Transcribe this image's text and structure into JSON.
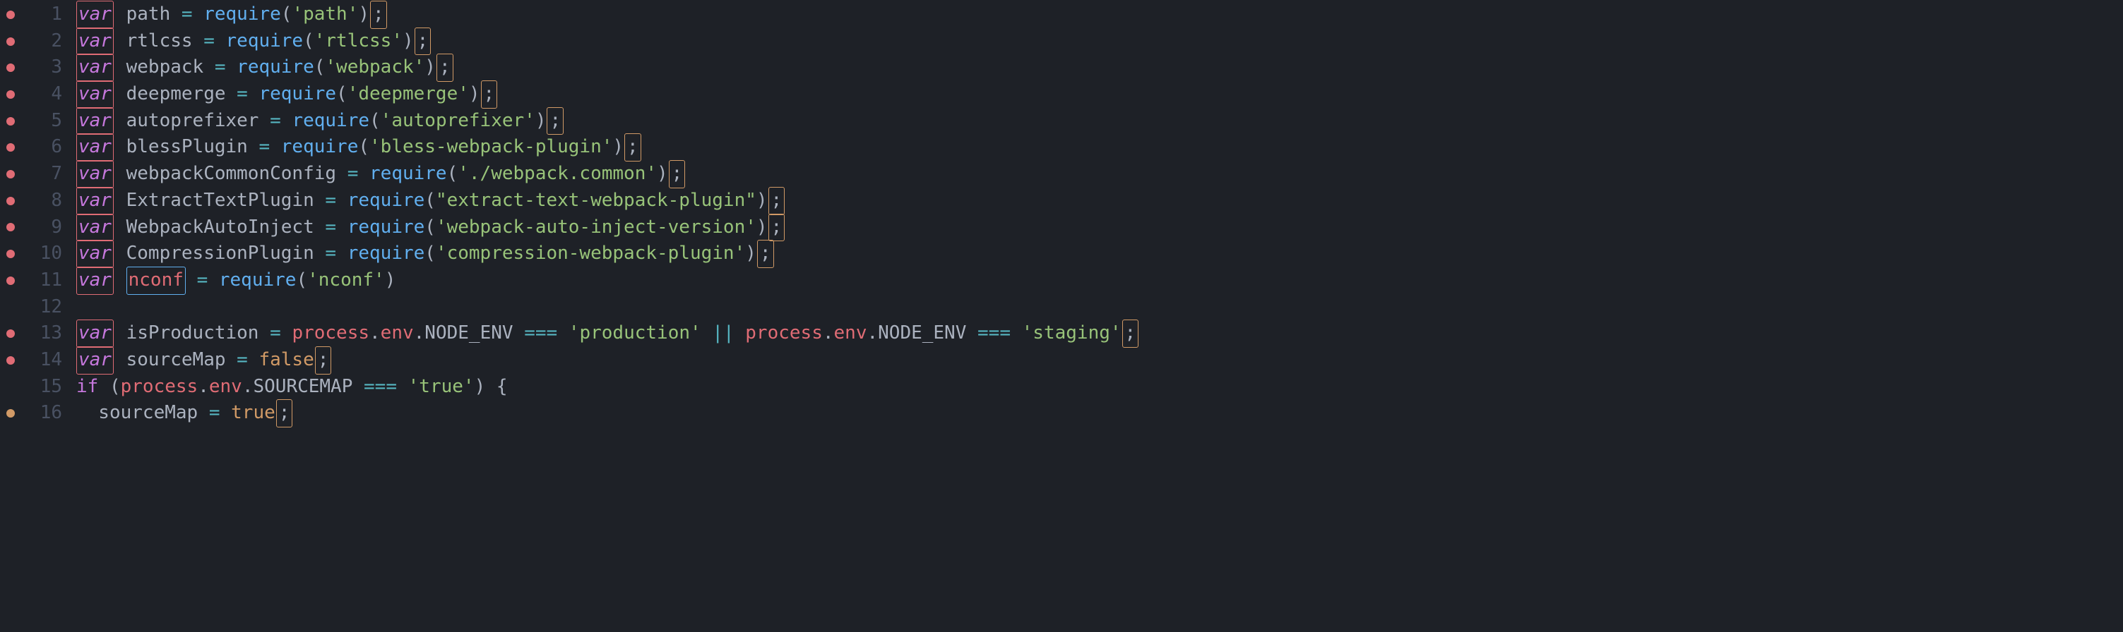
{
  "lines": [
    {
      "num": 1,
      "dot": "red",
      "tokens": [
        [
          "box-var",
          "var"
        ],
        [
          "ident",
          " path "
        ],
        [
          "op",
          "="
        ],
        [
          "ident",
          " "
        ],
        [
          "func",
          "require"
        ],
        [
          "punc",
          "("
        ],
        [
          "str",
          "'path'"
        ],
        [
          "punc",
          ")"
        ],
        [
          "box-semi",
          ";"
        ]
      ]
    },
    {
      "num": 2,
      "dot": "red",
      "tokens": [
        [
          "box-var",
          "var"
        ],
        [
          "ident",
          " rtlcss "
        ],
        [
          "op",
          "="
        ],
        [
          "ident",
          " "
        ],
        [
          "func",
          "require"
        ],
        [
          "punc",
          "("
        ],
        [
          "str",
          "'rtlcss'"
        ],
        [
          "punc",
          ")"
        ],
        [
          "box-semi",
          ";"
        ]
      ]
    },
    {
      "num": 3,
      "dot": "red",
      "tokens": [
        [
          "box-var",
          "var"
        ],
        [
          "ident",
          " webpack "
        ],
        [
          "op",
          "="
        ],
        [
          "ident",
          " "
        ],
        [
          "func",
          "require"
        ],
        [
          "punc",
          "("
        ],
        [
          "str",
          "'webpack'"
        ],
        [
          "punc",
          ")"
        ],
        [
          "box-semi",
          ";"
        ]
      ]
    },
    {
      "num": 4,
      "dot": "red",
      "tokens": [
        [
          "box-var",
          "var"
        ],
        [
          "ident",
          " deepmerge "
        ],
        [
          "op",
          "="
        ],
        [
          "ident",
          " "
        ],
        [
          "func",
          "require"
        ],
        [
          "punc",
          "("
        ],
        [
          "str",
          "'deepmerge'"
        ],
        [
          "punc",
          ")"
        ],
        [
          "box-semi",
          ";"
        ]
      ]
    },
    {
      "num": 5,
      "dot": "red",
      "tokens": [
        [
          "box-var",
          "var"
        ],
        [
          "ident",
          " autoprefixer "
        ],
        [
          "op",
          "="
        ],
        [
          "ident",
          " "
        ],
        [
          "func",
          "require"
        ],
        [
          "punc",
          "("
        ],
        [
          "str",
          "'autoprefixer'"
        ],
        [
          "punc",
          ")"
        ],
        [
          "box-semi",
          ";"
        ]
      ]
    },
    {
      "num": 6,
      "dot": "red",
      "tokens": [
        [
          "box-var",
          "var"
        ],
        [
          "ident",
          " blessPlugin "
        ],
        [
          "op",
          "="
        ],
        [
          "ident",
          " "
        ],
        [
          "func",
          "require"
        ],
        [
          "punc",
          "("
        ],
        [
          "str",
          "'bless-webpack-plugin'"
        ],
        [
          "punc",
          ")"
        ],
        [
          "box-semi",
          ";"
        ]
      ]
    },
    {
      "num": 7,
      "dot": "red",
      "tokens": [
        [
          "box-var",
          "var"
        ],
        [
          "ident",
          " webpackCommonConfig "
        ],
        [
          "op",
          "="
        ],
        [
          "ident",
          " "
        ],
        [
          "func",
          "require"
        ],
        [
          "punc",
          "("
        ],
        [
          "str",
          "'./webpack.common'"
        ],
        [
          "punc",
          ")"
        ],
        [
          "box-semi",
          ";"
        ]
      ]
    },
    {
      "num": 8,
      "dot": "red",
      "tokens": [
        [
          "box-var",
          "var"
        ],
        [
          "ident",
          " ExtractTextPlugin "
        ],
        [
          "op",
          "="
        ],
        [
          "ident",
          " "
        ],
        [
          "func",
          "require"
        ],
        [
          "punc",
          "("
        ],
        [
          "str",
          "\"extract-text-webpack-plugin\""
        ],
        [
          "punc",
          ")"
        ],
        [
          "box-semi",
          ";"
        ]
      ]
    },
    {
      "num": 9,
      "dot": "red",
      "tokens": [
        [
          "box-var",
          "var"
        ],
        [
          "ident",
          " WebpackAutoInject "
        ],
        [
          "op",
          "="
        ],
        [
          "ident",
          " "
        ],
        [
          "func",
          "require"
        ],
        [
          "punc",
          "("
        ],
        [
          "str",
          "'webpack-auto-inject-version'"
        ],
        [
          "punc",
          ")"
        ],
        [
          "box-semi",
          ";"
        ]
      ]
    },
    {
      "num": 10,
      "dot": "red",
      "tokens": [
        [
          "box-var",
          "var"
        ],
        [
          "ident",
          " CompressionPlugin "
        ],
        [
          "op",
          "="
        ],
        [
          "ident",
          " "
        ],
        [
          "func",
          "require"
        ],
        [
          "punc",
          "("
        ],
        [
          "str",
          "'compression-webpack-plugin'"
        ],
        [
          "punc",
          ")"
        ],
        [
          "box-semi",
          ";"
        ]
      ]
    },
    {
      "num": 11,
      "dot": "red",
      "tokens": [
        [
          "box-var",
          "var"
        ],
        [
          "ident",
          " "
        ],
        [
          "box-nconf",
          "nconf"
        ],
        [
          "ident",
          " "
        ],
        [
          "op",
          "="
        ],
        [
          "ident",
          " "
        ],
        [
          "func",
          "require"
        ],
        [
          "punc",
          "("
        ],
        [
          "str",
          "'nconf'"
        ],
        [
          "punc",
          ")"
        ]
      ]
    },
    {
      "num": 12,
      "dot": "",
      "tokens": []
    },
    {
      "num": 13,
      "dot": "red",
      "tokens": [
        [
          "box-var",
          "var"
        ],
        [
          "ident",
          " isProduction "
        ],
        [
          "op",
          "="
        ],
        [
          "ident",
          " "
        ],
        [
          "prop",
          "process"
        ],
        [
          "punc",
          "."
        ],
        [
          "prop",
          "env"
        ],
        [
          "punc",
          "."
        ],
        [
          "ident",
          "NODE_ENV "
        ],
        [
          "op",
          "==="
        ],
        [
          "ident",
          " "
        ],
        [
          "str",
          "'production'"
        ],
        [
          "ident",
          " "
        ],
        [
          "op",
          "||"
        ],
        [
          "ident",
          " "
        ],
        [
          "prop",
          "process"
        ],
        [
          "punc",
          "."
        ],
        [
          "prop",
          "env"
        ],
        [
          "punc",
          "."
        ],
        [
          "ident",
          "NODE_ENV "
        ],
        [
          "op",
          "==="
        ],
        [
          "ident",
          " "
        ],
        [
          "str",
          "'staging'"
        ],
        [
          "box-semi",
          ";"
        ]
      ]
    },
    {
      "num": 14,
      "dot": "red",
      "tokens": [
        [
          "box-var",
          "var"
        ],
        [
          "ident",
          " sourceMap "
        ],
        [
          "op",
          "="
        ],
        [
          "ident",
          " "
        ],
        [
          "const",
          "false"
        ],
        [
          "box-semi",
          ";"
        ]
      ]
    },
    {
      "num": 15,
      "dot": "",
      "tokens": [
        [
          "kw-kw",
          "if"
        ],
        [
          "ident",
          " "
        ],
        [
          "punc",
          "("
        ],
        [
          "prop",
          "process"
        ],
        [
          "punc",
          "."
        ],
        [
          "prop",
          "env"
        ],
        [
          "punc",
          "."
        ],
        [
          "ident",
          "SOURCEMAP "
        ],
        [
          "op",
          "==="
        ],
        [
          "ident",
          " "
        ],
        [
          "str",
          "'true'"
        ],
        [
          "punc",
          ")"
        ],
        [
          "ident",
          " "
        ],
        [
          "punc",
          "{"
        ]
      ]
    },
    {
      "num": 16,
      "dot": "yellow",
      "tokens": [
        [
          "ident",
          "  sourceMap "
        ],
        [
          "op",
          "="
        ],
        [
          "ident",
          " "
        ],
        [
          "const",
          "true"
        ],
        [
          "box-semi",
          ";"
        ]
      ]
    }
  ]
}
